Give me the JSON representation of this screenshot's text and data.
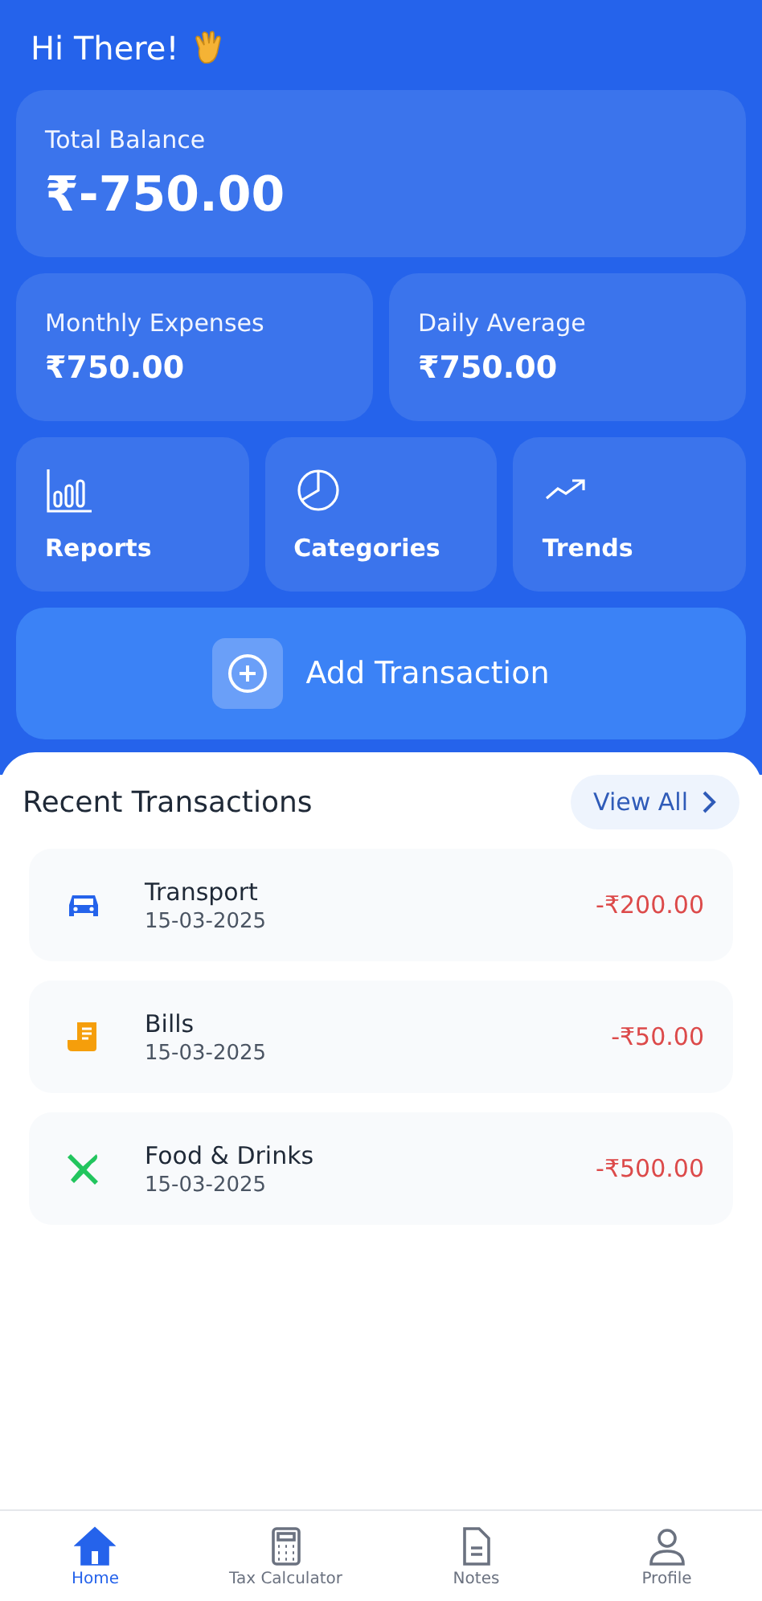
{
  "greeting": "Hi There!",
  "balance": {
    "label": "Total Balance",
    "value": "₹-750.00"
  },
  "stats": [
    {
      "label": "Monthly Expenses",
      "value": "₹750.00"
    },
    {
      "label": "Daily Average",
      "value": "₹750.00"
    }
  ],
  "shortcuts": [
    {
      "kind": "reports",
      "label": "Reports"
    },
    {
      "kind": "categories",
      "label": "Categories"
    },
    {
      "kind": "trends",
      "label": "Trends"
    }
  ],
  "add_button": "Add Transaction",
  "recent": {
    "title": "Recent Transactions",
    "view_all": "View All"
  },
  "transactions": [
    {
      "kind": "transport",
      "color": "#2563eb",
      "name": "Transport",
      "date": "15-03-2025",
      "amount": "-₹200.00"
    },
    {
      "kind": "bills",
      "color": "#f59e0b",
      "name": "Bills",
      "date": "15-03-2025",
      "amount": "-₹50.00"
    },
    {
      "kind": "food",
      "color": "#22c55e",
      "name": "Food & Drinks",
      "date": "15-03-2025",
      "amount": "-₹500.00"
    }
  ],
  "nav": [
    {
      "kind": "home",
      "label": "Home",
      "selected": true
    },
    {
      "kind": "calculator",
      "label": "Tax Calculator",
      "selected": false
    },
    {
      "kind": "notes",
      "label": "Notes",
      "selected": false
    },
    {
      "kind": "profile",
      "label": "Profile",
      "selected": false
    }
  ]
}
